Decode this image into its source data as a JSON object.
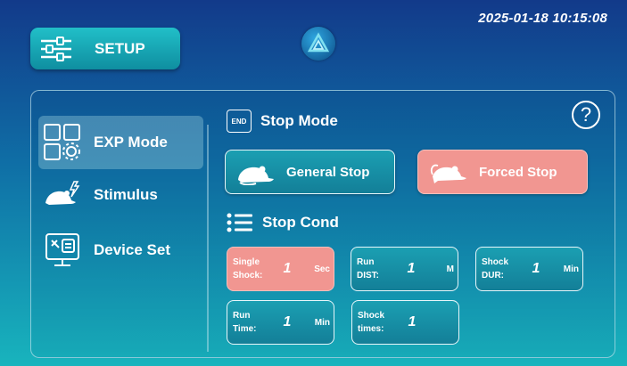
{
  "datetime": "2025-01-18 10:15:08",
  "setup": {
    "label": "SETUP"
  },
  "sidebar": {
    "items": [
      {
        "label": "EXP Mode",
        "active": true
      },
      {
        "label": "Stimulus",
        "active": false
      },
      {
        "label": "Device Set",
        "active": false
      }
    ]
  },
  "stop_mode": {
    "title": "Stop Mode",
    "badge": "END",
    "general": "General Stop",
    "forced": "Forced Stop"
  },
  "help": {
    "label": "?"
  },
  "stop_cond": {
    "title": "Stop Cond",
    "items": [
      {
        "label": "Single Shock:",
        "value": "1",
        "unit": "Sec",
        "selected": true
      },
      {
        "label": "Run DIST:",
        "value": "1",
        "unit": "M",
        "selected": false
      },
      {
        "label": "Shock DUR:",
        "value": "1",
        "unit": "Min",
        "selected": false
      },
      {
        "label": "Run Time:",
        "value": "1",
        "unit": "Min",
        "selected": false
      },
      {
        "label": "Shock times:",
        "value": "1",
        "unit": "",
        "selected": false
      }
    ]
  },
  "colors": {
    "accent_teal": "#1b9fb2",
    "accent_pink": "#f19691"
  }
}
